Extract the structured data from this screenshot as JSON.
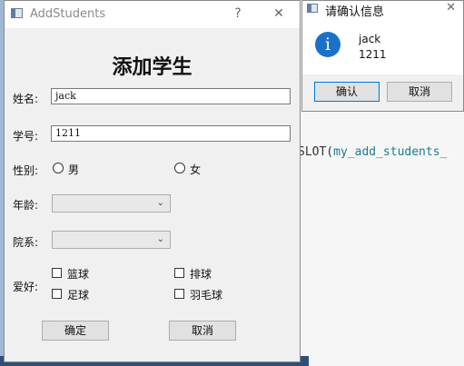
{
  "background": {
    "code_prefix": "SLOT(",
    "code_function": "my_add_students_"
  },
  "main_dialog": {
    "title": "AddStudents",
    "help_button": "?",
    "close_button": "✕",
    "heading": "添加学生",
    "name_label": "姓名:",
    "name_value": "jack",
    "id_label": "学号:",
    "id_value": "1211",
    "gender_label": "性别:",
    "gender_options": [
      "男",
      "女"
    ],
    "age_label": "年龄:",
    "age_value": "",
    "dept_label": "院系:",
    "dept_value": "",
    "hobby_label": "爱好:",
    "hobbies": [
      "篮球",
      "排球",
      "足球",
      "羽毛球"
    ],
    "ok_button": "确定",
    "cancel_button": "取消"
  },
  "confirm_dialog": {
    "title": "请确认信息",
    "close_button": "✕",
    "info_icon": "i",
    "lines": [
      "jack",
      "1211"
    ],
    "ok_button": "确认",
    "cancel_button": "取消"
  },
  "colors": {
    "info_icon": "#1a72c8",
    "dialog_bg": "#f0f0f0"
  }
}
